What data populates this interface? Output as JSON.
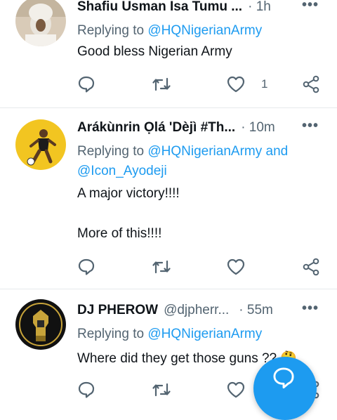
{
  "tweets": [
    {
      "author": "Shafiu Usman Isa Tumu ...",
      "handle": "",
      "time": "· 1h",
      "replying_prefix": "Replying to",
      "replying_to": "@HQNigerianArmy",
      "replying_extra": "",
      "text_lines": [
        "Good bless Nigerian Army"
      ],
      "like_count": "1"
    },
    {
      "author": "Arákùnrin Ọlá 'Dèjì #Th...",
      "handle": "",
      "time": "· 10m",
      "replying_prefix": "Replying to",
      "replying_to": "@HQNigerianArmy",
      "replying_and": "and",
      "replying_extra": "@Icon_Ayodeji",
      "text_lines": [
        "A major victory!!!!",
        "More of this!!!!"
      ],
      "like_count": ""
    },
    {
      "author": "DJ PHEROW",
      "handle": "@djpherr...",
      "time": "· 55m",
      "replying_prefix": "Replying to",
      "replying_to": "@HQNigerianArmy",
      "replying_extra": "",
      "text_lines": [
        "Where did they get those guns ?? 🤔"
      ],
      "like_count": ""
    }
  ],
  "more_icon": "more-dots-icon",
  "colors": {
    "accent": "#1d9bf0",
    "muted": "#536471",
    "divider": "#e6e9ec"
  },
  "fab_icon": "compose-reply-icon"
}
